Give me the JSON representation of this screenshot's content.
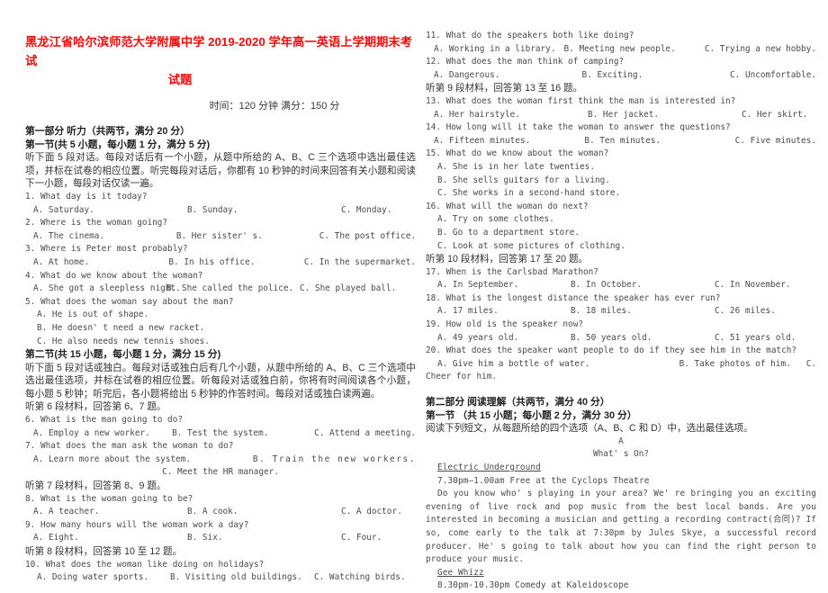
{
  "document": {
    "title_line1": "黑龙江省哈尔滨师范大学附属中学 2019-2020 学年高一英语上学期期末考试",
    "title_line2": "试题",
    "exam_meta": "时间：120 分钟    满分：150 分",
    "title_color": "#f40b0b"
  },
  "part1": {
    "heading": "第一部分 听力（共两节，满分 20 分）",
    "section1_heading": "第一节(共 5 小题，每小题 1 分，满分 5 分)",
    "section1_instructions": "听下面 5 段对话。每段对话后有一个小题，从题中所给的 A、B、C 三个选项中选出最佳选项，并标在试卷的相应位置。听完每段对话后，你都有 10 秒钟的时间来回答有关小题和阅读下一小题，每段对话仅读一遍。",
    "section2_heading": "第二节(共 15 小题，每小题 1 分，满分 15 分)",
    "section2_instructions": "听下面 5 段对话或独白。每段对话或独白后有几个小题，从题中所给的 A、B、C 三个选项中选出最佳选项，并标在试卷的相应位置。听每段对话或独白前，你将有时间阅读各个小题，每小题 5 秒钟；听完后，各小题将给出 5 秒钟的作答时间。每段对话或独白读两遍。",
    "material6_note": "听第 6 段材料，回答第 6、7 题。",
    "material7_note": "听第 7 段材料，回答第 8、9 题。",
    "material8_note": "听第 8 段材料，回答第 10 至 12 题。",
    "material9_note": "听第 9 段材料，回答第 13 至 16 题。",
    "material10_note": "听第 10 段材料，回答第 17 至 20 题。",
    "questions": [
      {
        "num": "1.",
        "stem": "What day is it today?",
        "options": [
          "A. Saturday.",
          "B. Sunday.",
          "C. Monday."
        ],
        "layout": "row"
      },
      {
        "num": "2.",
        "stem": "Where is the woman going?",
        "options": [
          "A. The cinema.",
          "B. Her sister' s.",
          "C. The post office."
        ],
        "layout": "row"
      },
      {
        "num": "3.",
        "stem": "Where is Peter most probably?",
        "options": [
          "A. At home.",
          "B. In his office.",
          "C. In the supermarket."
        ],
        "layout": "row"
      },
      {
        "num": "4.",
        "stem": "What do we know about the woman?",
        "options": [
          "A. She got a sleepless night.",
          "B. She called the police.",
          "C. She played ball."
        ],
        "layout": "row-tight"
      },
      {
        "num": "5.",
        "stem": "What does the woman say about the man?",
        "options": [
          "A. He is out of shape.",
          "B. He doesn' t need a new racket.",
          "C. He also needs new tennis shoes."
        ],
        "layout": "stack"
      },
      {
        "num": "6.",
        "stem": "What is the man going to do?",
        "options": [
          "A. Employ a new worker.",
          "B. Test the system.",
          "C. Attend a meeting."
        ],
        "layout": "row-tight2"
      },
      {
        "num": "7.",
        "stem": "What does the man ask the woman to do?",
        "options": [
          "A. Learn more about the system.",
          "B. Train the new workers.",
          "C. Meet the HR manager."
        ],
        "layout": "split-two-then-center"
      },
      {
        "num": "8.",
        "stem": "What is the woman going to be?",
        "options": [
          "A. A teacher.",
          "B. A cook.",
          "C. A doctor."
        ],
        "layout": "row"
      },
      {
        "num": "9.",
        "stem": "How many hours will the woman work a day?",
        "options": [
          "A. Eight.",
          "B. Six.",
          "C. Four."
        ],
        "layout": "row"
      },
      {
        "num": "10.",
        "stem": "What does the woman like doing on holidays?",
        "options": [
          "A. Doing water sports.",
          "B. Visiting old buildings.",
          "C. Watching birds."
        ],
        "layout": "row-tight3"
      },
      {
        "num": "11.",
        "stem": "What do the speakers both like doing?",
        "options": [
          "A. Working in a library.",
          "B. Meeting new people.",
          "C. Trying a new hobby."
        ],
        "layout": "row-tight3"
      },
      {
        "num": "12.",
        "stem": "What does the man think of camping?",
        "options": [
          "A. Dangerous.",
          "B. Exciting.",
          "C. Uncomfortable."
        ],
        "layout": "row"
      },
      {
        "num": "13.",
        "stem": "What does the woman first think the man is interested in?",
        "options": [
          "A. Her hairstyle.",
          "B. Her jacket.",
          "C. Her skirt."
        ],
        "layout": "row"
      },
      {
        "num": "14.",
        "stem": "How long will it take the woman to answer the questions?",
        "options": [
          "A. Fifteen minutes.",
          "B. Ten minutes.",
          "C. Five minutes."
        ],
        "layout": "row"
      },
      {
        "num": "15.",
        "stem": "What do we know about the woman?",
        "options": [
          "A. She is in her late twenties.",
          "B. She sells guitars for a living.",
          "C. She works in a second-hand store."
        ],
        "layout": "stack"
      },
      {
        "num": "16.",
        "stem": "What will the woman do next?",
        "options": [
          "A. Try on some clothes.",
          "B. Go to a department store.",
          "C. Look at some pictures of clothing."
        ],
        "layout": "stack"
      },
      {
        "num": "17.",
        "stem": "When is the Carlsbad Marathon?",
        "options": [
          "A. In September.",
          "B. In October.",
          "C. In November."
        ],
        "layout": "row"
      },
      {
        "num": "18.",
        "stem": "What is the longest distance the speaker has ever run?",
        "options": [
          "A. 17 miles.",
          "B. 18 miles.",
          "C. 26 miles."
        ],
        "layout": "row"
      },
      {
        "num": "19.",
        "stem": "How old is the speaker now?",
        "options": [
          "A. 49 years old.",
          "B. 50 years old.",
          "C. 51 years old."
        ],
        "layout": "row"
      },
      {
        "num": "20.",
        "stem": "What does the speaker want people to do if they see him in the match?",
        "options": [
          "A. Give him a bottle of water.",
          "B. Take photos of him.",
          "C."
        ],
        "wrap_tail": "Cheer for him.",
        "layout": "wrap"
      }
    ]
  },
  "part2": {
    "heading": "第二部分 阅读理解（共两节，满分 40 分）",
    "section1_heading": "第一节 （共 15 小题；每小题 2 分，满分 30 分）",
    "section1_instructions": "阅读下列短文，从每题所给的四个选项（A、B、C 和 D）中，选出最佳选项。",
    "passage_letter": "A",
    "passage_title": "What' s On?",
    "entries": [
      {
        "name": "Electric Underground",
        "time": "7.30pm—1.00am Free at the Cyclops Theatre",
        "body": "Do you know who' s playing in your area? We' re bringing you an exciting evening of live rock and pop music from the best local bands. Are you interested in becoming a musician and getting a recording contract(合同)? If so, come early to the talk at 7:30pm by Jules Skye, a successful record producer. He' s going to talk about how you can find the right person to produce your music."
      },
      {
        "name": "Gee Whizz",
        "time": "8.30pm-10.30pm Comedy at Kaleidoscope",
        "body": ""
      }
    ]
  }
}
